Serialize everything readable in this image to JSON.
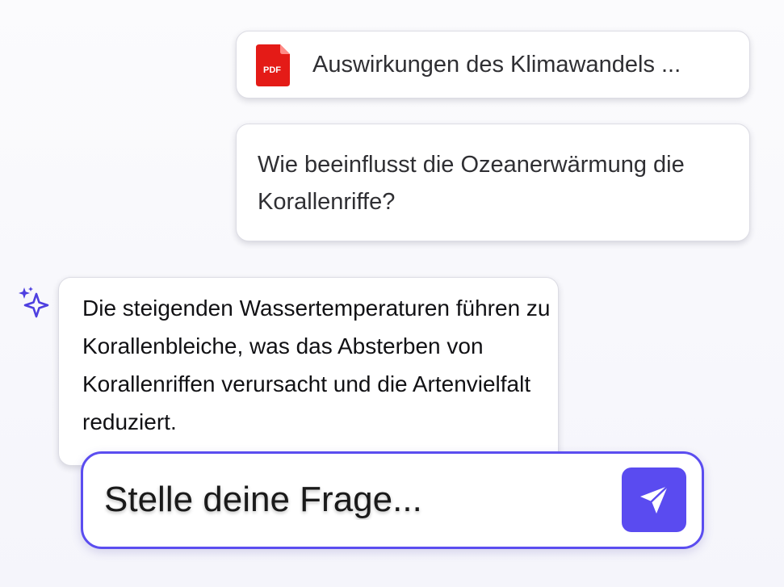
{
  "chat": {
    "attachment": {
      "icon": "pdf-file-icon",
      "icon_text": "PDF",
      "file_name": "Auswirkungen des Klimawandels ..."
    },
    "user_question": "Wie beeinflusst die Ozeanerwärmung die Korallenriffe?",
    "assistant": {
      "icon": "sparkles-icon",
      "answer": "Die steigenden Wassertemperaturen führen zu Korallenbleiche, was das Absterben von Korallenriffen verursacht und die Artenvielfalt reduziert."
    }
  },
  "composer": {
    "placeholder": "Stelle deine Frage...",
    "value": "",
    "send_icon": "send-icon"
  },
  "colors": {
    "accent": "#5a4bf0",
    "pdf_red": "#e41b17",
    "background": "#f7f7fb",
    "bubble": "#ffffff"
  }
}
